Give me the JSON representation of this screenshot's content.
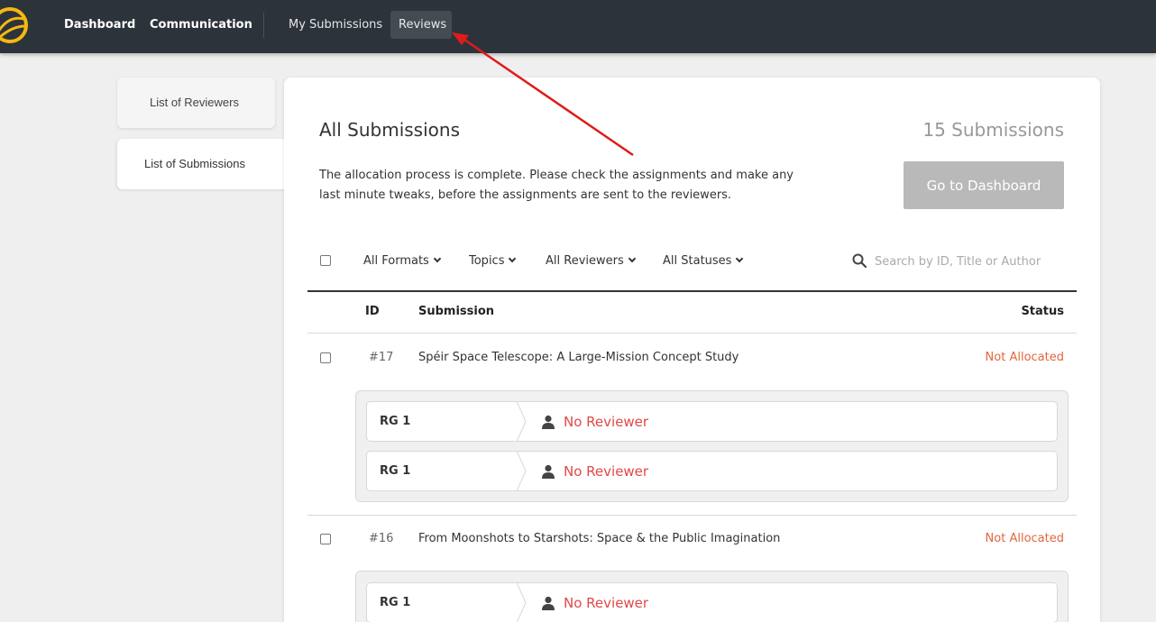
{
  "nav": {
    "logo_icon": "app-logo-icon",
    "items": [
      "Dashboard",
      "Communication"
    ],
    "subitems": [
      "My Submissions",
      "Reviews"
    ]
  },
  "sidebar": {
    "items": [
      "List of Reviewers",
      "List of Submissions"
    ],
    "active": "List of Submissions"
  },
  "main": {
    "title": "All Submissions",
    "count": "15 Submissions",
    "description": "The allocation process is complete. Please check the assignments and make any last minute tweaks, before the assignments are sent to the reviewers.",
    "dashboard_button": "Go to Dashboard",
    "filters": [
      "All Formats",
      "Topics",
      "All Reviewers",
      "All Statuses"
    ],
    "search_placeholder": "Search by ID, Title or Author",
    "columns": {
      "id": "ID",
      "submission": "Submission",
      "status": "Status"
    },
    "rows": [
      {
        "id": "#17",
        "title": "Spéir Space Telescope: A Large-Mission Concept Study",
        "status": "Not Allocated",
        "groups": [
          {
            "label": "RG 1",
            "reviewer": "No Reviewer"
          },
          {
            "label": "RG 1",
            "reviewer": "No Reviewer"
          }
        ]
      },
      {
        "id": "#16",
        "title": "From Moonshots to Starshots: Space & the Public Imagination",
        "status": "Not Allocated",
        "groups": [
          {
            "label": "RG 1",
            "reviewer": "No Reviewer"
          }
        ]
      }
    ]
  },
  "colors": {
    "nav_bg": "#2d333b",
    "status_not_allocated": "#e2673c",
    "no_reviewer": "#e04848",
    "annotation_arrow": "#e01b1b"
  }
}
